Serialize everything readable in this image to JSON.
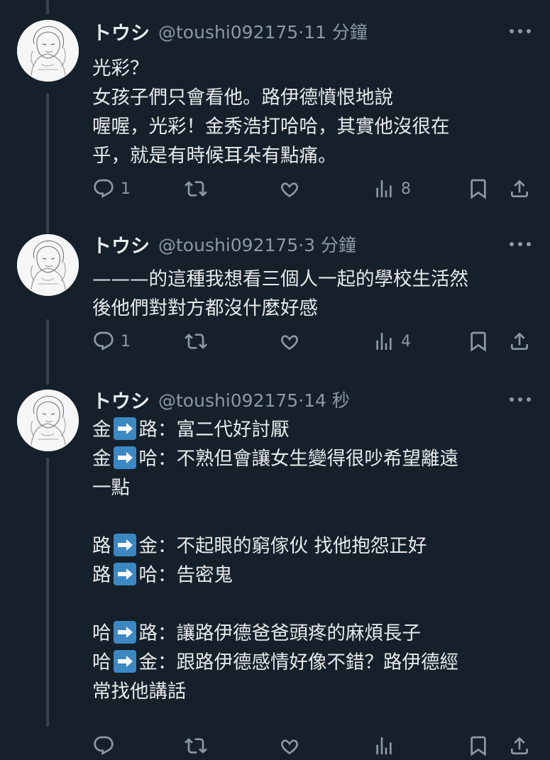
{
  "tweets": [
    {
      "name": "トウシ",
      "handle": "@toushi092175",
      "time": "11 分鐘",
      "lines": [
        "光彩？",
        "女孩子們只會看他。路伊德憤恨地說",
        "喔喔，光彩！金秀浩打哈哈，其實他沒很在",
        "乎，就是有時候耳朵有點痛。"
      ],
      "replies": "1",
      "views": "8"
    },
    {
      "name": "トウシ",
      "handle": "@toushi092175",
      "time": "3 分鐘",
      "lines": [
        "———的這種我想看三個人一起的學校生活然",
        "後他們對對方都沒什麼好感"
      ],
      "replies": "1",
      "views": "4"
    },
    {
      "name": "トウシ",
      "handle": "@toushi092175",
      "time": "14 秒",
      "lines": [
        {
          "a": "金",
          "b": "路：富二代好討厭"
        },
        {
          "a": "金",
          "b": "哈：不熟但會讓女生變得很吵希望離遠"
        },
        "一點",
        "",
        {
          "a": "路",
          "b": "金：不起眼的窮傢伙 找他抱怨正好"
        },
        {
          "a": "路",
          "b": "哈：告密鬼"
        },
        "",
        {
          "a": "哈",
          "b": "路：讓路伊德爸爸頭疼的麻煩長子"
        },
        {
          "a": "哈",
          "b": "金：跟路伊德感情好像不錯？路伊德經"
        },
        "常找他講話"
      ]
    }
  ],
  "icons": [
    "reply-icon",
    "retweet-icon",
    "like-icon",
    "views-icon",
    "bookmark-icon",
    "share-icon",
    "more-icon",
    "right-arrow-emoji"
  ],
  "colors": {
    "background": "#15202b",
    "text": "#e7e9ea",
    "muted": "#8b98a5",
    "thread_line": "#38444d",
    "emoji_blue": "#3b88c3"
  }
}
